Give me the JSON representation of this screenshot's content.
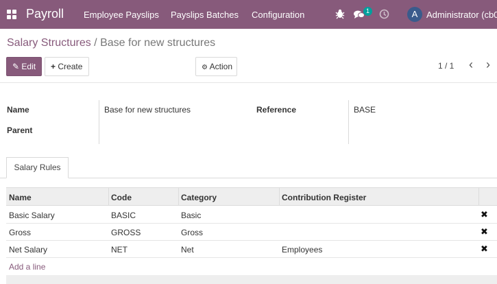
{
  "navbar": {
    "app_name": "Payroll",
    "menu": [
      "Employee Payslips",
      "Payslips Batches",
      "Configuration"
    ],
    "icons": [
      "apps-grid-icon",
      "bug-icon",
      "chat-icon",
      "clock-icon"
    ],
    "chat_badge": "1",
    "avatar_letter": "A",
    "user": "Administrator (cb05"
  },
  "breadcrumb": {
    "parent": "Salary Structures",
    "separator": "/",
    "current": "Base for new structures"
  },
  "toolbar": {
    "edit_label": "Edit",
    "create_label": "Create",
    "action_label": "Action",
    "pager": "1 / 1",
    "prev": "‹",
    "next": "›"
  },
  "form": {
    "name_label": "Name",
    "name_value": "Base for new structures",
    "reference_label": "Reference",
    "reference_value": "BASE",
    "parent_label": "Parent",
    "parent_value": ""
  },
  "tabs": [
    {
      "label": "Salary Rules"
    }
  ],
  "table": {
    "headers": [
      "Name",
      "Code",
      "Category",
      "Contribution Register"
    ],
    "rows": [
      {
        "name": "Basic Salary",
        "code": "BASIC",
        "category": "Basic",
        "register": ""
      },
      {
        "name": "Gross",
        "code": "GROSS",
        "category": "Gross",
        "register": ""
      },
      {
        "name": "Net Salary",
        "code": "NET",
        "category": "Net",
        "register": "Employees"
      }
    ],
    "delete_glyph": "✖",
    "add_line": "Add a line"
  },
  "colors": {
    "brand": "#875a7b",
    "badge": "#00a09d",
    "avatar": "#3a5b8c"
  }
}
